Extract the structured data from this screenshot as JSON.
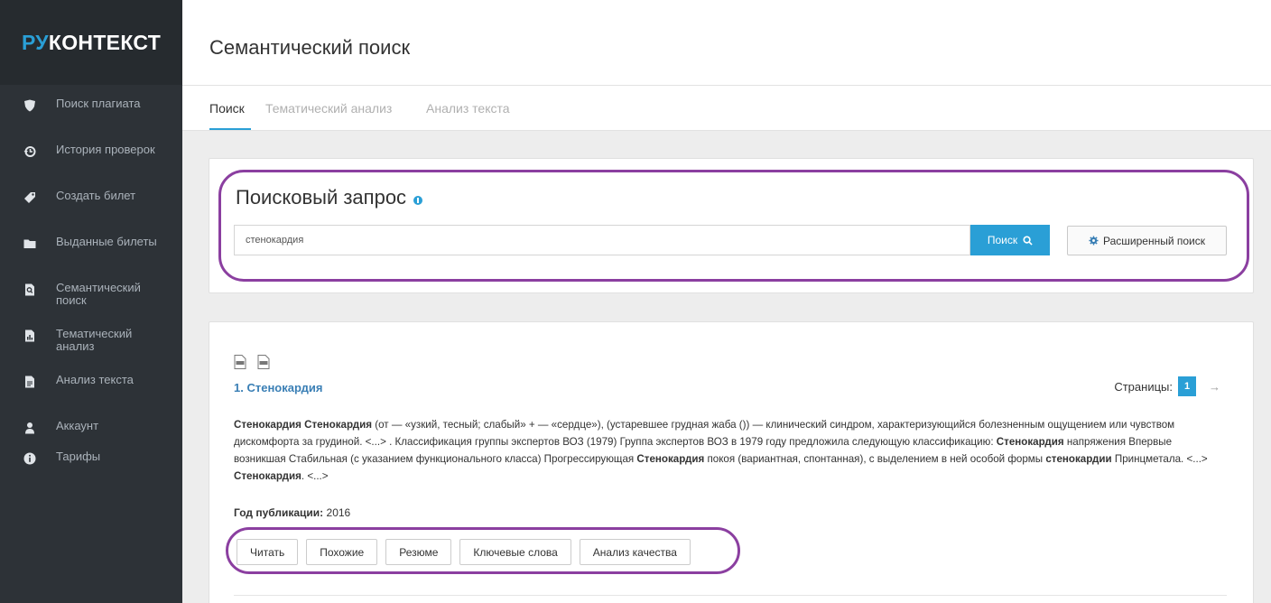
{
  "brand": {
    "ru": "РУ",
    "rest": "КОНТЕКСТ"
  },
  "sidebar": {
    "items": [
      {
        "label": "Поиск плагиата",
        "icon": "shield-icon"
      },
      {
        "label": "История проверок",
        "icon": "history-icon"
      },
      {
        "label": "Создать билет",
        "icon": "tag-icon"
      },
      {
        "label": "Выданные билеты",
        "icon": "folder-icon"
      },
      {
        "label": "Семантический поиск",
        "icon": "search-doc-icon"
      },
      {
        "label": "Тематический анализ",
        "icon": "chart-doc-icon"
      },
      {
        "label": "Анализ текста",
        "icon": "document-icon"
      },
      {
        "label": "Аккаунт",
        "icon": "user-icon"
      },
      {
        "label": "Тарифы",
        "icon": "info-icon"
      }
    ]
  },
  "header": {
    "title": "Семантический поиск"
  },
  "tabs": [
    {
      "label": "Поиск",
      "active": true
    },
    {
      "label": "Тематический анализ",
      "active": false
    },
    {
      "label": "Анализ текста",
      "active": false
    }
  ],
  "search": {
    "title": "Поисковый запрос",
    "value": "стенокардия",
    "button_label": "Поиск",
    "advanced_label": "Расширенный поиск"
  },
  "result": {
    "title": "1. Стенокардия",
    "pages_label": "Страницы:",
    "current_page": "1",
    "next_arrow": "→",
    "snippet": [
      {
        "t": "Стенокардия",
        "b": true
      },
      {
        "t": " ",
        "b": false
      },
      {
        "t": "Стенокардия",
        "b": true
      },
      {
        "t": " (от — «узкий, тесный; слабый» + — «сердце»), (устаревшее грудная жаба ()) — клинический синдром, характеризующийся болезненным ощущением или чувством дискомфорта за грудиной. <...> . Классификация группы экспертов ВОЗ (1979) Группа экспертов ВОЗ в 1979 году предложила следующую классификацию: ",
        "b": false
      },
      {
        "t": "Стенокардия",
        "b": true
      },
      {
        "t": " напряжения Впервые возникшая Стабильная (с указанием функционального класса) Прогрессирующая ",
        "b": false
      },
      {
        "t": "Стенокардия",
        "b": true
      },
      {
        "t": " покоя (вариантная, спонтанная), с выделением в ней особой формы ",
        "b": false
      },
      {
        "t": "стенокардии",
        "b": true
      },
      {
        "t": " Принцметала. <...> ",
        "b": false
      },
      {
        "t": "Стенокардия",
        "b": true
      },
      {
        "t": ". <...>",
        "b": false
      }
    ],
    "year_label": "Год публикации:",
    "year_value": "2016",
    "actions": [
      "Читать",
      "Похожие",
      "Резюме",
      "Ключевые слова",
      "Анализ качества"
    ]
  },
  "colors": {
    "accent": "#2a9fd6",
    "sidebar": "#2d3237",
    "highlight": "#8b3fa0"
  }
}
